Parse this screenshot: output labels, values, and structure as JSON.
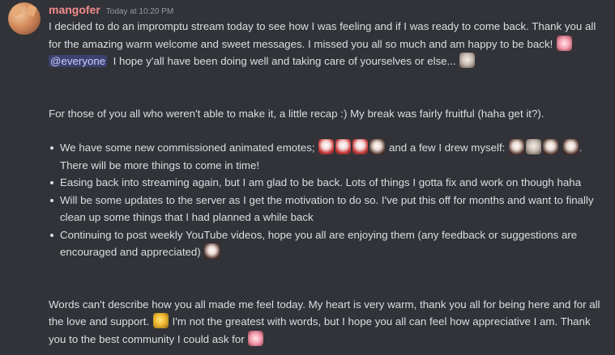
{
  "message": {
    "author": "mangofer",
    "timestamp": "Today at 10:20 PM",
    "intro_before_mention": "I decided to do an impromptu stream today to see how I was feeling and if I was ready to come back. Thank you all for the amazing warm welcome and sweet messages. I missed you all so much and am happy to be back!",
    "mention": "@everyone",
    "intro_after_mention": "I hope y'all have been doing well and taking care of yourselves or else...",
    "recap_intro": "For those of you all who weren't able to make it, a little recap :) My break was fairly fruitful (haha get it?).",
    "bullets": [
      {
        "part1": "We have some new commissioned animated emotes;",
        "part2": "and a few I drew myself:",
        "part3": ". There will be more things to come in time!"
      },
      {
        "text": "Easing back into streaming again, but I am glad to be back. Lots of things I gotta fix and work on though haha"
      },
      {
        "text": "Will be some updates to the server as I get the motivation to do so. I've put this off for months and want to finally clean up some things that I had planned a while back"
      },
      {
        "text": "Continuing to post weekly YouTube videos, hope you all are enjoying them (any feedback or suggestions are encouraged and appreciated)"
      }
    ],
    "closing_part1": "Words can't describe how you all made me feel today. My heart is very warm, thank you all for being here and for all the love and support.",
    "closing_part2": "I'm not the greatest with words, but I hope you all can feel how appreciative I am. Thank you to the best community I could ask for",
    "colors": {
      "background": "#313338",
      "username": "#f38b8b",
      "text": "#dbdee1",
      "timestamp": "#949ba4",
      "mention_bg": "#3c4270",
      "mention_text": "#c9cdfb"
    },
    "emotes": [
      "pink-hearts-emote",
      "gray-peek-emote",
      "red-mask-emote",
      "chibi-dance-emote",
      "yellow-thumbs-emote"
    ]
  }
}
